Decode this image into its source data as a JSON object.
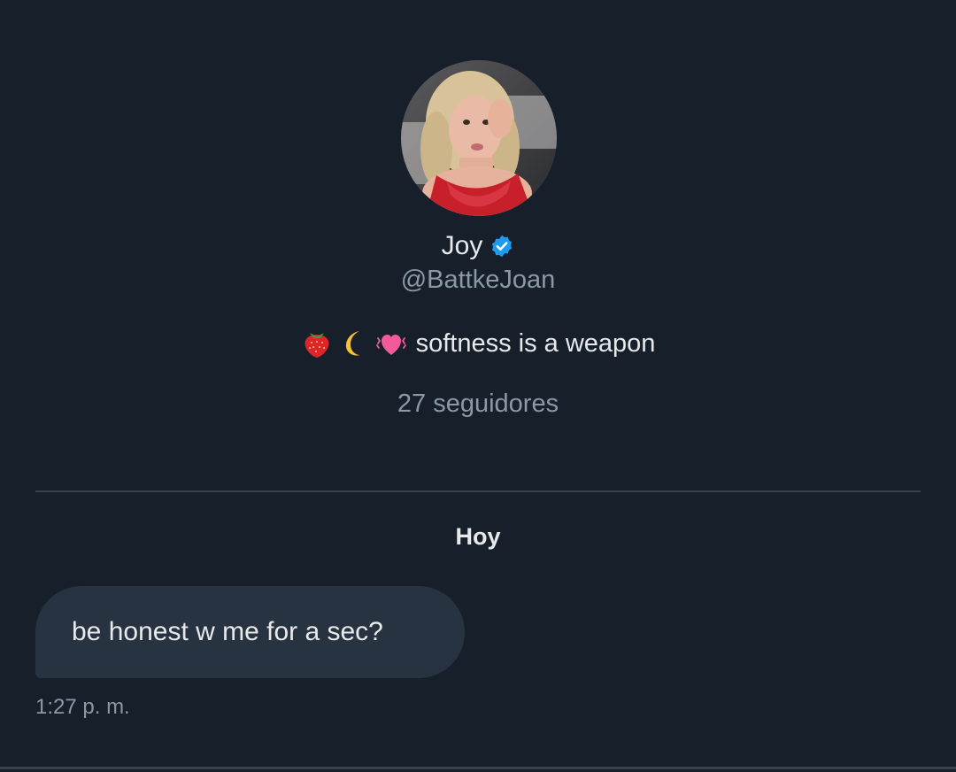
{
  "profile": {
    "display_name": "Joy",
    "handle": "@BattkeJoan",
    "verified_icon": "verified-badge-icon",
    "avatar_icon": "profile-photo",
    "bio": {
      "emojis": [
        "strawberry-icon",
        "crescent-moon-icon",
        "vibrating-heart-icon"
      ],
      "text": "softness is a weapon"
    },
    "followers": "27 seguidores"
  },
  "conversation": {
    "date_separator": "Hoy",
    "messages": [
      {
        "text": "be honest w me for a sec?",
        "time": "1:27 p. m.",
        "direction": "incoming"
      }
    ]
  },
  "colors": {
    "background": "#17202a",
    "bubble": "#273340",
    "primary_text": "#e7e9ea",
    "secondary_text": "#8b98a5",
    "divider": "#38444d",
    "verified_blue": "#1d9bf0"
  }
}
